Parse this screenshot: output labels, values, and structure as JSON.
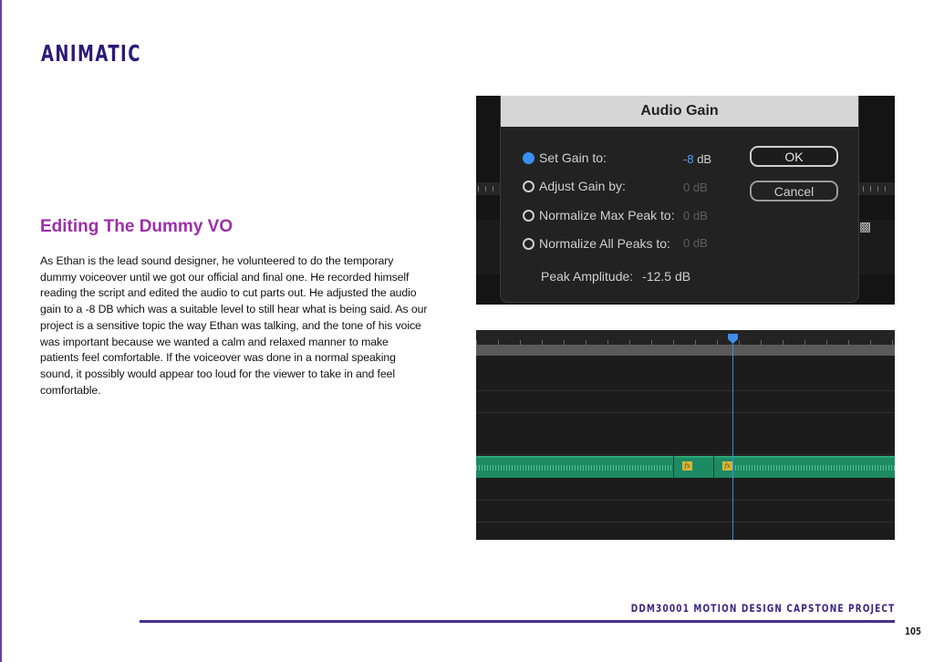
{
  "page": {
    "title": "ANIMATIC",
    "section_heading": "Editing The Dummy VO",
    "body": "As Ethan is the lead sound designer, he volunteered to do the temporary dummy voiceover until we got our official and final one. He recorded himself reading the script and edited the audio to cut parts out. He adjusted the audio gain to a -8 DB which was a suitable level to still hear what is being said. As our project is a sensitive topic the way Ethan was talking, and the tone of his voice was important because we wanted a calm and relaxed manner to make patients feel comfortable.  If the voiceover was done in a normal speaking sound, it possibly would appear too loud for the viewer to take in and feel comfortable.",
    "footer_title": "DDM30001 MOTION DESIGN CAPSTONE PROJECT",
    "page_number": "105",
    "accent_color": "#2d1a78",
    "heading_color": "#9b2fa8"
  },
  "audio_gain_dialog": {
    "title": "Audio Gain",
    "options": [
      {
        "label": "Set Gain to:",
        "value": "-8",
        "unit": "dB",
        "selected": true
      },
      {
        "label": "Adjust Gain by:",
        "value": "0",
        "unit": "dB",
        "selected": false
      },
      {
        "label": "Normalize Max Peak to:",
        "value": "0",
        "unit": "dB",
        "selected": false
      },
      {
        "label": "Normalize All Peaks to:",
        "value": "0",
        "unit": "dB",
        "selected": false
      }
    ],
    "peak_label": "Peak Amplitude:",
    "peak_value": "-12.5 dB",
    "ok_label": "OK",
    "cancel_label": "Cancel",
    "selected_color": "#3b8ff0"
  },
  "timeline": {
    "clip_badges": [
      "fx",
      "fx"
    ],
    "clip_color": "#1d8a63",
    "playhead_color": "#3d8ee8"
  }
}
